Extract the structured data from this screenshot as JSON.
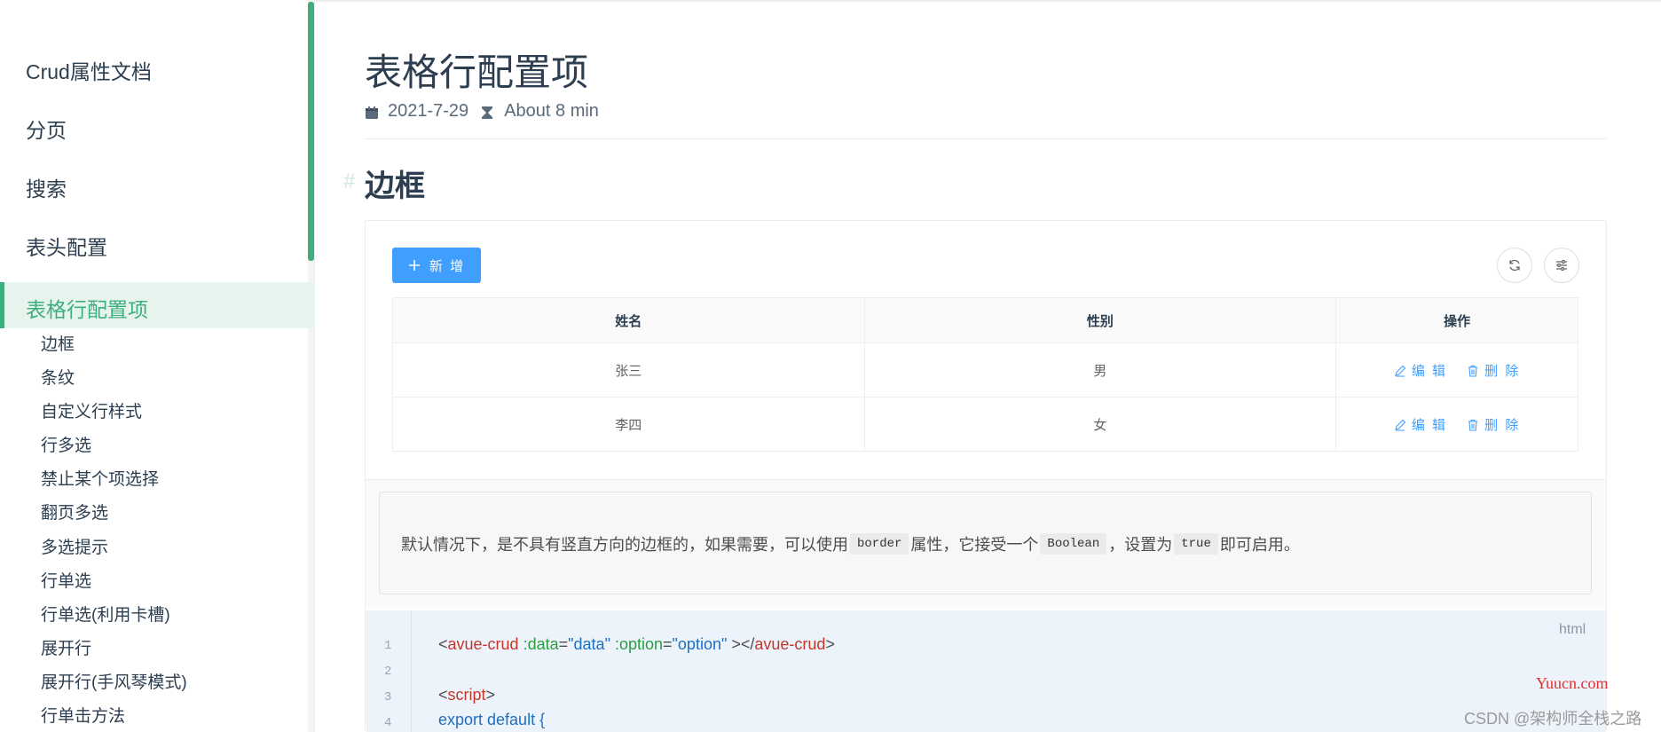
{
  "sidebar": {
    "top_items": [
      "Crud属性文档",
      "分页",
      "搜索",
      "表头配置"
    ],
    "active_item": "表格行配置项",
    "sub_items": [
      "边框",
      "条纹",
      "自定义行样式",
      "行多选",
      "禁止某个项选择",
      "翻页多选",
      "多选提示",
      "行单选",
      "行单选(利用卡槽)",
      "展开行",
      "展开行(手风琴模式)",
      "行单击方法"
    ]
  },
  "page": {
    "title": "表格行配置项",
    "date": "2021-7-29",
    "read_time": "About 8 min",
    "section_heading": "边框",
    "anchor": "#"
  },
  "toolbar": {
    "add_label": "新 增",
    "add_icon": "plus-icon",
    "refresh_icon": "refresh-icon",
    "columns_icon": "column-settings-icon"
  },
  "table": {
    "headers": [
      "姓名",
      "性别",
      "操作"
    ],
    "rows": [
      {
        "name": "张三",
        "gender": "男"
      },
      {
        "name": "李四",
        "gender": "女"
      }
    ],
    "edit_label": "编 辑",
    "delete_label": "删 除"
  },
  "description": {
    "part1": "默认情况下，是不具有竖直方向的边框的，如果需要，可以使用",
    "code1": "border",
    "part2": "属性，它接受一个",
    "code2": "Boolean",
    "part3": "，设置为",
    "code3": "true",
    "part4": "即可启用。"
  },
  "code": {
    "lang": "html",
    "line_numbers": [
      "1",
      "2",
      "3",
      "4"
    ],
    "line1": {
      "open": "<",
      "tag": "avue-crud",
      "attr1": ":data",
      "eq": "=",
      "val1": "\"data\"",
      "attr2": ":option",
      "val2": "\"option\"",
      "close": " ></",
      "tag2": "avue-crud",
      "end": ">"
    },
    "line3": {
      "open": "<",
      "tag": "script",
      "end": ">"
    },
    "line4": "export default {"
  },
  "watermarks": {
    "site": "Yuucn.com",
    "csdn": "CSDN @架构师全栈之路"
  },
  "colors": {
    "accent": "#3eaf7c",
    "primary": "#409eff"
  }
}
